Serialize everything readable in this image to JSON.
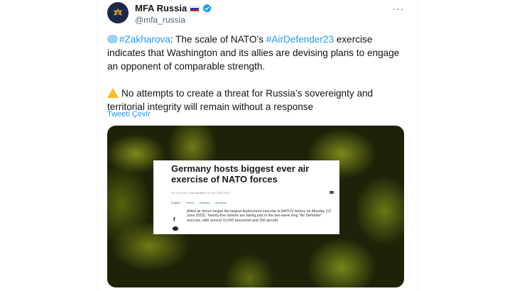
{
  "tweet": {
    "author_name": "MFA Russia",
    "author_handle": "@mfa_russia",
    "more_label": "···",
    "hashtag_1": "#Zakharova",
    "text_1a": ": The scale of NATO’s ",
    "hashtag_2": "#AirDefender23",
    "text_1b": " exercise indicates that Washington and its allies are devising plans to engage an opponent of comparable strength.",
    "text_2": "No attempts to create a threat for Russia’s sovereignty and territorial integrity will remain without a response",
    "translate_label": "Tweeti Çevir"
  },
  "article": {
    "title": "Germany hosts biggest ever air exercise of NATO forces",
    "meta": "12 Jun 2023  |  Last updated: 12 Jun 2023 15:07",
    "languages": [
      "English",
      "French",
      "Russian",
      "Ukrainian"
    ],
    "body": "Allied air forces began the largest deployment exercise in NATO's history on Monday (12 June 2023). Twenty-five nations are taking part in the two-week long \"Air Defender\" exercise, with around 10,000 personnel and 250 aircraft.",
    "facebook_glyph": "f"
  },
  "icons": {
    "avatar": "coat-of-arms-icon",
    "flag": "russia-flag-icon",
    "verified": "verified-badge-icon",
    "speech": "speech-bubble-icon",
    "warning": "warning-icon"
  },
  "colors": {
    "link": "#1d9bf0",
    "secondary_text": "#536471",
    "verified": "#1d9bf0"
  }
}
